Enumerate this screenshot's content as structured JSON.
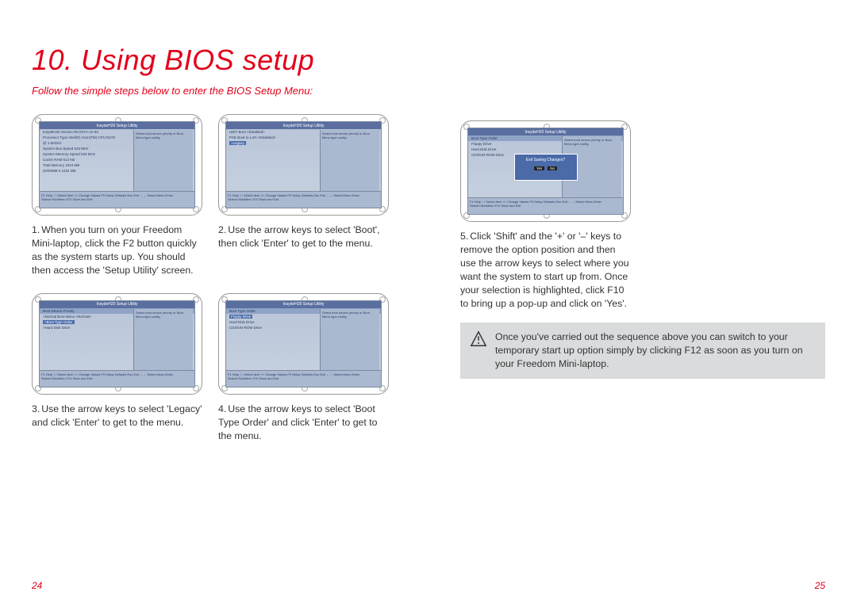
{
  "heading": "10. Using BIOS setup",
  "subtitle": "Follow the simple steps below to enter the BIOS Setup Menu:",
  "steps": {
    "s1": {
      "num": "1.",
      "text": "When you turn on your Freedom Mini-laptop, click the F2 button quickly as the system starts up. You should then access the 'Setup Utility' screen."
    },
    "s2": {
      "num": "2.",
      "text": "Use the arrow keys to select 'Boot', then click 'Enter' to get to the menu."
    },
    "s3": {
      "num": "3.",
      "text": "Use the arrow keys to select 'Legacy' and click 'Enter' to get to the menu."
    },
    "s4": {
      "num": "4.",
      "text": "Use the arrow keys to select 'Boot Type Order' and click 'Enter' to get to the menu."
    },
    "s5": {
      "num": "5.",
      "text": "Click 'Shift' and the '+' or '–' keys to remove the option position and then use the arrow keys to select where you want the system to start up from. Once your selection is highlighted, click F10 to bring up a pop-up and click on 'Yes'."
    }
  },
  "note": "Once you've carried out the sequence above you can switch to your temporary start up option simply by clicking F12 as soon as you turn on your Freedom Mini-laptop.",
  "page_left": "24",
  "page_right": "25",
  "bios": {
    "title": "InsydeH20 Setup Utility",
    "main_rows": [
      "InsydeH20 Version     R0.03YA-12-03",
      "Processor Type        Intel(R) Atom(TM) CPU N270",
      "                      @ 1.60GHz",
      "System Bus Speed      533 MHz",
      "System Memory Speed   533 MHz",
      "Cache RAM             512 KB",
      "Total Memory          1024 MB",
      "SODIMM 0              1024 MB"
    ],
    "boot_rows": [
      "UEFI Boot             <Disabled>",
      "PXE Boot to LAN       <Disabled>",
      ">Legacy"
    ],
    "legacy_rows": [
      ">Normal Boot Menu     <Normal>",
      ">Boot Type Order",
      ">Hard Disk Drive"
    ],
    "order_rows": [
      "Boot Type Order",
      " Floppy Drive",
      " Hard Disk Drive",
      " CD/DVD-ROM Drive"
    ],
    "order_rows_5": [
      "Boot Type Order",
      " Floppy Drive",
      " Hard Disk Drive",
      " CD/DVD-ROM Drive"
    ],
    "help_text": "Select boot device priority or Boot Menu type config.",
    "foot_text": "F1 Help  ↑↓ Select Item  +/- Change Values  F9 Setup Defaults  Esc Exit  ←→ Select Menu  Enter Select>SubMenu  F10 Save and Exit",
    "dialog": "Exit Saving Changes?",
    "dialog_yes": "Yes",
    "dialog_no": "No"
  }
}
